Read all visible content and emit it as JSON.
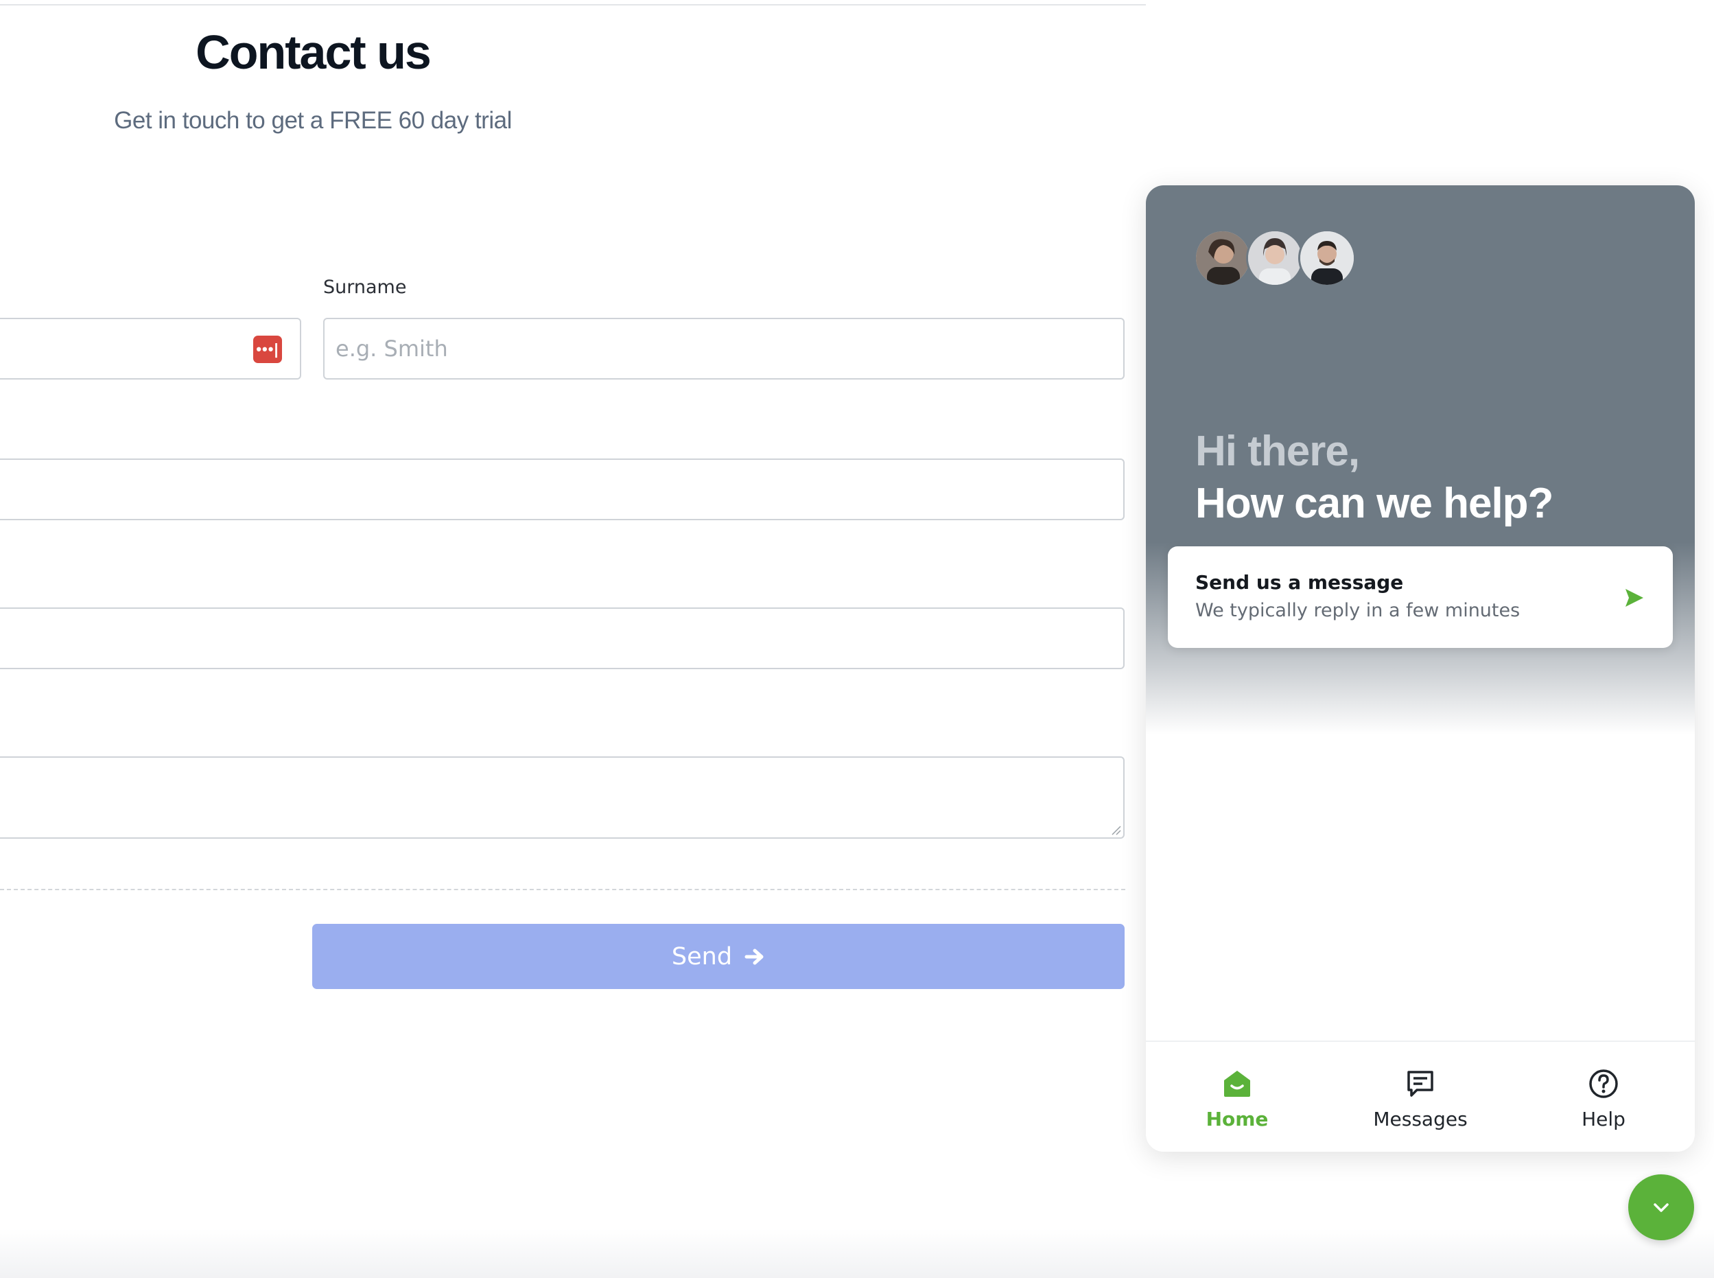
{
  "page": {
    "title": "Contact us",
    "subtitle": "Get in touch to get a FREE 60 day trial"
  },
  "form": {
    "surname_label": "Surname",
    "surname_placeholder": "e.g. Smith",
    "password_manager_icon": "password-manager-icon",
    "send_label": "Send"
  },
  "widget": {
    "greeting_line1": "Hi there,",
    "greeting_line2": "How can we help?",
    "card_title": "Send us a message",
    "card_subtitle": "We typically reply in a few minutes",
    "nav": [
      {
        "label": "Home",
        "icon": "home-icon",
        "active": true
      },
      {
        "label": "Messages",
        "icon": "messages-icon",
        "active": false
      },
      {
        "label": "Help",
        "icon": "help-icon",
        "active": false
      }
    ],
    "accent_color": "#5bb23a",
    "header_color": "#6e7a84"
  },
  "colors": {
    "send_button": "#9aaeef",
    "password_icon": "#d9473f"
  }
}
